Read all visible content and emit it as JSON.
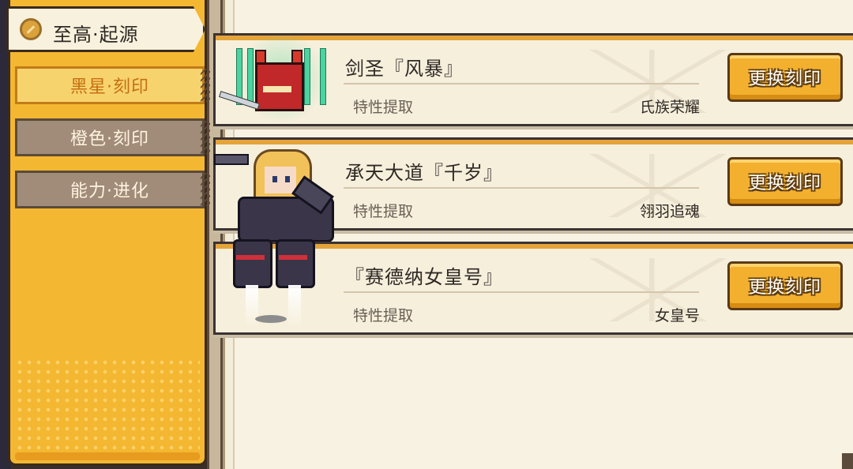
{
  "sidebar": {
    "header_title": "至高·起源",
    "tabs": [
      {
        "label": "黑星·刻印",
        "active": true
      },
      {
        "label": "橙色·刻印",
        "active": false
      },
      {
        "label": "能力·进化",
        "active": false
      }
    ]
  },
  "cards": [
    {
      "name": "剑圣『风暴』",
      "sub_label": "特性提取",
      "sub_value": "氏族荣耀",
      "button": "更换刻印",
      "portrait_icon": "demon-swordsman-icon"
    },
    {
      "name": "承天大道『千岁』",
      "sub_label": "特性提取",
      "sub_value": "翎羽追魂",
      "button": "更换刻印",
      "portrait_icon": "mech-girl-icon"
    },
    {
      "name": "『赛德纳女皇号』",
      "sub_label": "特性提取",
      "sub_value": "女皇号",
      "button": "更换刻印",
      "portrait_icon": "mech-legs-icon"
    }
  ],
  "colors": {
    "panel_orange": "#f4b731",
    "button_gold": "#f3b02e",
    "card_bg": "#f6efdc"
  }
}
